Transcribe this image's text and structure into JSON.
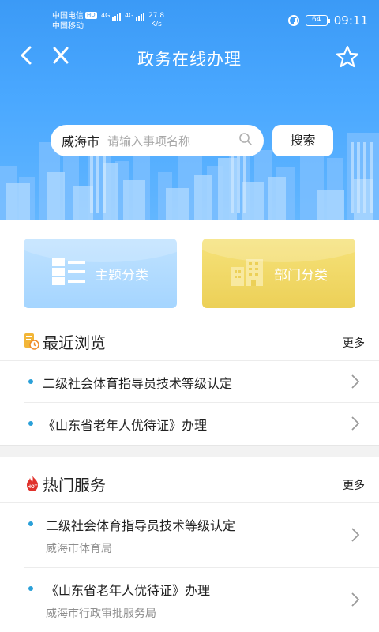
{
  "status_bar": {
    "carrier_1": "中国电信",
    "carrier_1_badge": "HD",
    "carrier_2": "中国移动",
    "net_1": "4G",
    "net_2": "4G",
    "speed_value": "27.8",
    "speed_unit": "K/s",
    "battery": "64",
    "time": "09:11"
  },
  "nav": {
    "title": "政务在线办理"
  },
  "search": {
    "city": "威海市",
    "placeholder": "请输入事项名称",
    "button": "搜索"
  },
  "categories": [
    {
      "label": "主题分类",
      "color": "#a9d6ff",
      "icon": "grid-list-icon"
    },
    {
      "label": "部门分类",
      "color": "#f0d75c",
      "icon": "buildings-icon"
    }
  ],
  "recent": {
    "title": "最近浏览",
    "more": "更多",
    "items": [
      {
        "text": "二级社会体育指导员技术等级认定"
      },
      {
        "text": "《山东省老年人优待证》办理"
      }
    ]
  },
  "hot": {
    "title": "热门服务",
    "more": "更多",
    "icon_label": "HOT",
    "items": [
      {
        "text": "二级社会体育指导员技术等级认定",
        "dept": "威海市体育局"
      },
      {
        "text": "《山东省老年人优待证》办理",
        "dept": "威海市行政审批服务局"
      }
    ]
  },
  "colors": {
    "header_blue": "#3b9af6",
    "dot_blue": "#2aa0d8",
    "topic_card": "#a9d6ff",
    "dept_card": "#f0d75c"
  }
}
